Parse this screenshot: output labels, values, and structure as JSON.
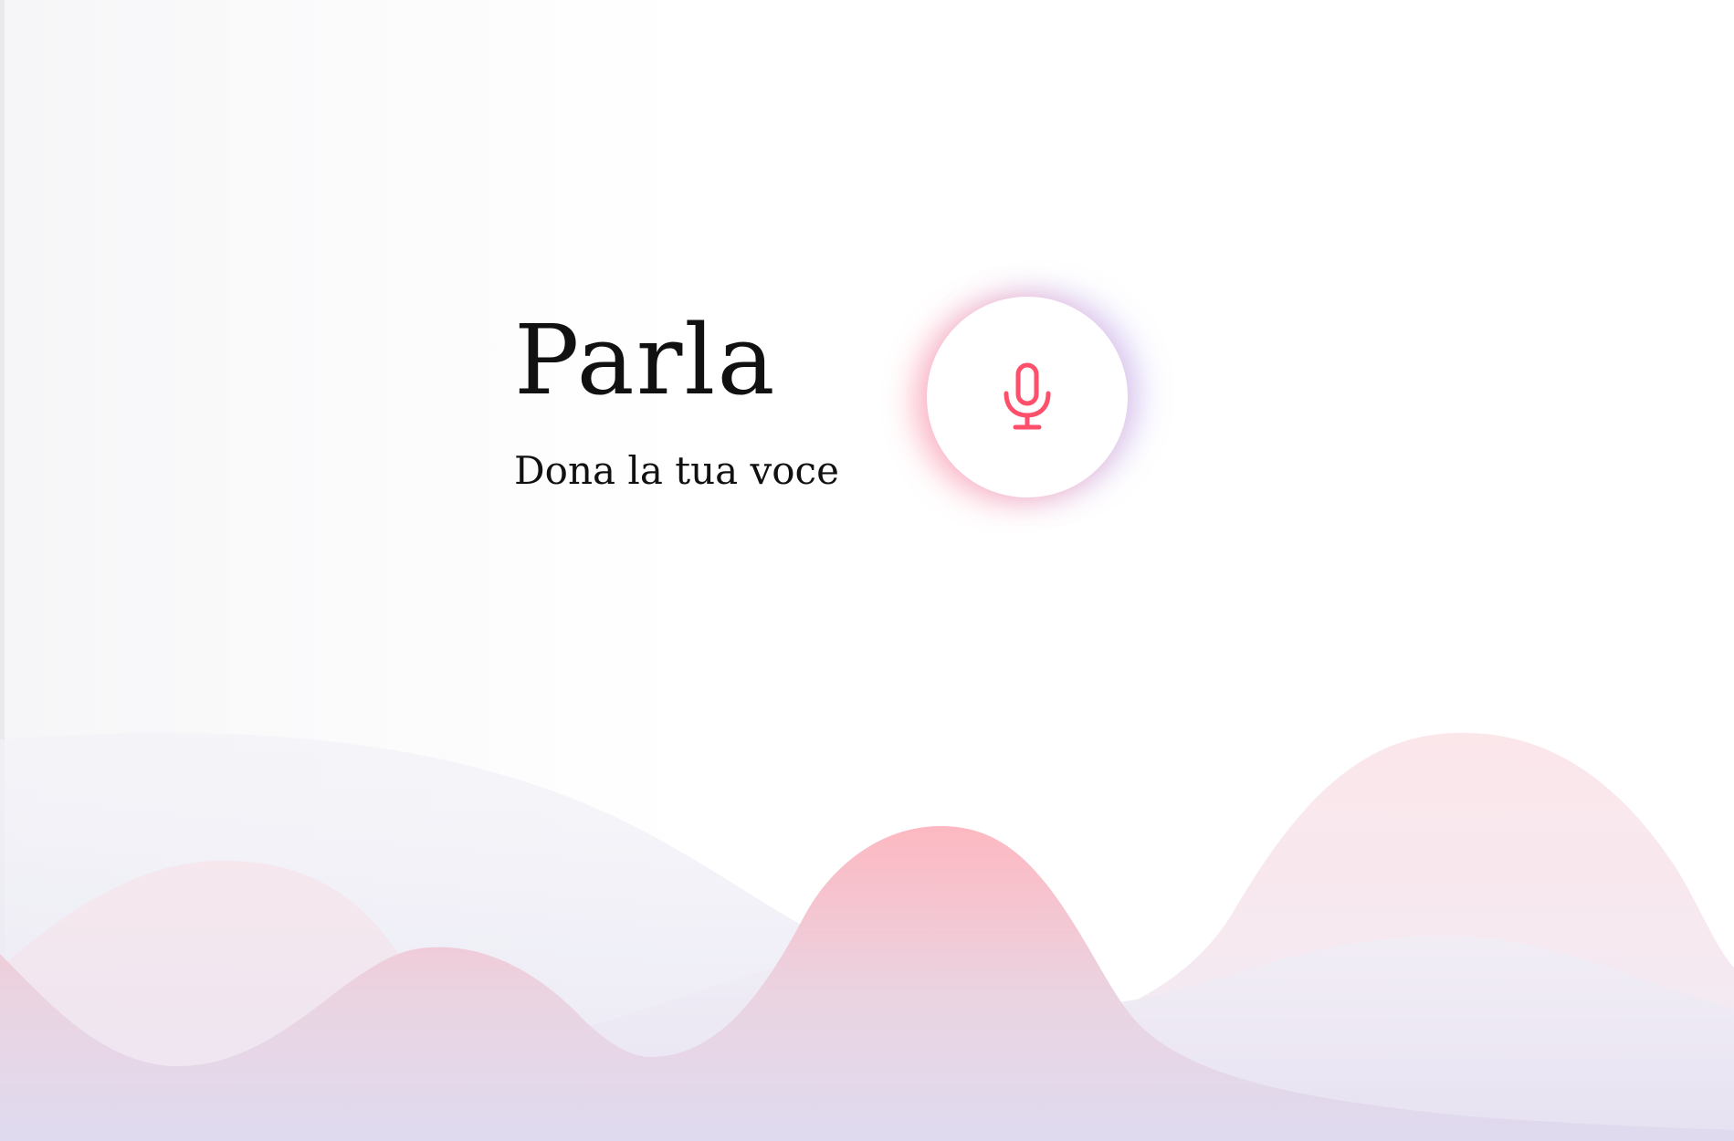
{
  "hero": {
    "title": "Parla",
    "subtitle": "Dona la tua voce"
  },
  "record_button": {
    "icon": "microphone-icon",
    "icon_color": "#ff4f6a"
  },
  "colors": {
    "accent_red": "#ff4f6a",
    "accent_purple": "#9b8cf0",
    "wave_pink": "#fdb6c1",
    "wave_lavender": "#dcd8ef",
    "text": "#111111"
  }
}
